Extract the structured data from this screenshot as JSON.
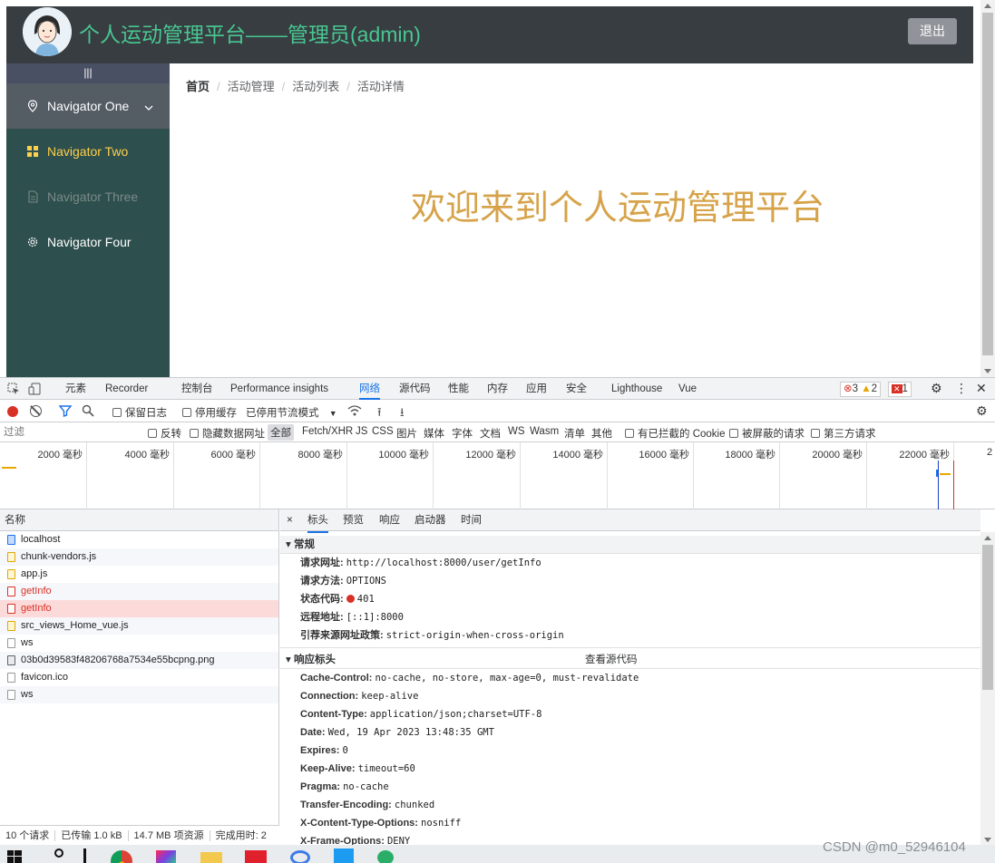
{
  "app": {
    "title": "个人运动管理平台——管理员(admin)",
    "logout_label": "退出",
    "collapse_glyph": "|||",
    "menu": [
      {
        "label": "Navigator One",
        "icon": "location-icon"
      },
      {
        "label": "Navigator Two",
        "icon": "grid-icon"
      },
      {
        "label": "Navigator Three",
        "icon": "document-icon"
      },
      {
        "label": "Navigator Four",
        "icon": "gear-icon"
      }
    ],
    "breadcrumb": [
      "首页",
      "活动管理",
      "活动列表",
      "活动详情"
    ],
    "welcome": "欢迎来到个人运动管理平台",
    "colors": {
      "header_bg": "#373d41",
      "title": "#49c691",
      "sidebar_bg": "#2d4f4d",
      "active_menu": "#ffd04b",
      "welcome": "#d6a34a"
    }
  },
  "devtools": {
    "tabs": [
      "元素",
      "Recorder",
      "控制台",
      "Performance insights",
      "网络",
      "源代码",
      "性能",
      "内存",
      "应用",
      "安全",
      "Lighthouse",
      "Vue"
    ],
    "active_tab": "网络",
    "errors": "3",
    "warnings": "2",
    "issues": "1",
    "toolbar": {
      "preserve_log": "保留日志",
      "disable_cache": "停用缓存",
      "throttle": "已停用节流模式"
    },
    "filter": {
      "placeholder": "过滤",
      "invert": "反转",
      "hide_data_urls": "隐藏数据网址",
      "types": [
        "全部",
        "Fetch/XHR",
        "JS",
        "CSS",
        "图片",
        "媒体",
        "字体",
        "文档",
        "WS",
        "Wasm",
        "清单",
        "其他"
      ],
      "blocked_cookies": "有已拦截的 Cookie",
      "blocked_requests": "被屏蔽的请求",
      "third_party": "第三方请求"
    },
    "timeline_ticks": [
      "2000 毫秒",
      "4000 毫秒",
      "6000 毫秒",
      "8000 毫秒",
      "10000 毫秒",
      "12000 毫秒",
      "14000 毫秒",
      "16000 毫秒",
      "18000 毫秒",
      "20000 毫秒",
      "22000 毫秒",
      "2"
    ],
    "name_header": "名称",
    "requests": [
      {
        "name": "localhost",
        "type": "doc"
      },
      {
        "name": "chunk-vendors.js",
        "type": "js"
      },
      {
        "name": "app.js",
        "type": "js"
      },
      {
        "name": "getInfo",
        "type": "err"
      },
      {
        "name": "getInfo",
        "type": "err"
      },
      {
        "name": "src_views_Home_vue.js",
        "type": "js"
      },
      {
        "name": "ws",
        "type": "other"
      },
      {
        "name": "03b0d39583f48206768a7534e55bcpng.png",
        "type": "img"
      },
      {
        "name": "favicon.ico",
        "type": "other"
      },
      {
        "name": "ws",
        "type": "other"
      }
    ],
    "status": [
      "10 个请求",
      "已传输 1.0 kB",
      "14.7 MB 项资源",
      "完成用时: 2"
    ],
    "detail_tabs": [
      "×",
      "标头",
      "预览",
      "响应",
      "启动器",
      "时间"
    ],
    "general": {
      "title": "常规",
      "rows": [
        {
          "k": "请求网址:",
          "v": "http://localhost:8000/user/getInfo"
        },
        {
          "k": "请求方法:",
          "v": "OPTIONS"
        },
        {
          "k": "状态代码:",
          "v": "401"
        },
        {
          "k": "远程地址:",
          "v": "[::1]:8000"
        },
        {
          "k": "引荐来源网址政策:",
          "v": "strict-origin-when-cross-origin"
        }
      ]
    },
    "response_headers": {
      "title": "响应标头",
      "view_source": "查看源代码",
      "rows": [
        {
          "k": "Cache-Control:",
          "v": "no-cache, no-store, max-age=0, must-revalidate"
        },
        {
          "k": "Connection:",
          "v": "keep-alive"
        },
        {
          "k": "Content-Type:",
          "v": "application/json;charset=UTF-8"
        },
        {
          "k": "Date:",
          "v": "Wed, 19 Apr 2023 13:48:35 GMT"
        },
        {
          "k": "Expires:",
          "v": "0"
        },
        {
          "k": "Keep-Alive:",
          "v": "timeout=60"
        },
        {
          "k": "Pragma:",
          "v": "no-cache"
        },
        {
          "k": "Transfer-Encoding:",
          "v": "chunked"
        },
        {
          "k": "X-Content-Type-Options:",
          "v": "nosniff"
        },
        {
          "k": "X-Frame-Options:",
          "v": "DENY"
        }
      ]
    }
  },
  "watermark": "CSDN @m0_52946104"
}
